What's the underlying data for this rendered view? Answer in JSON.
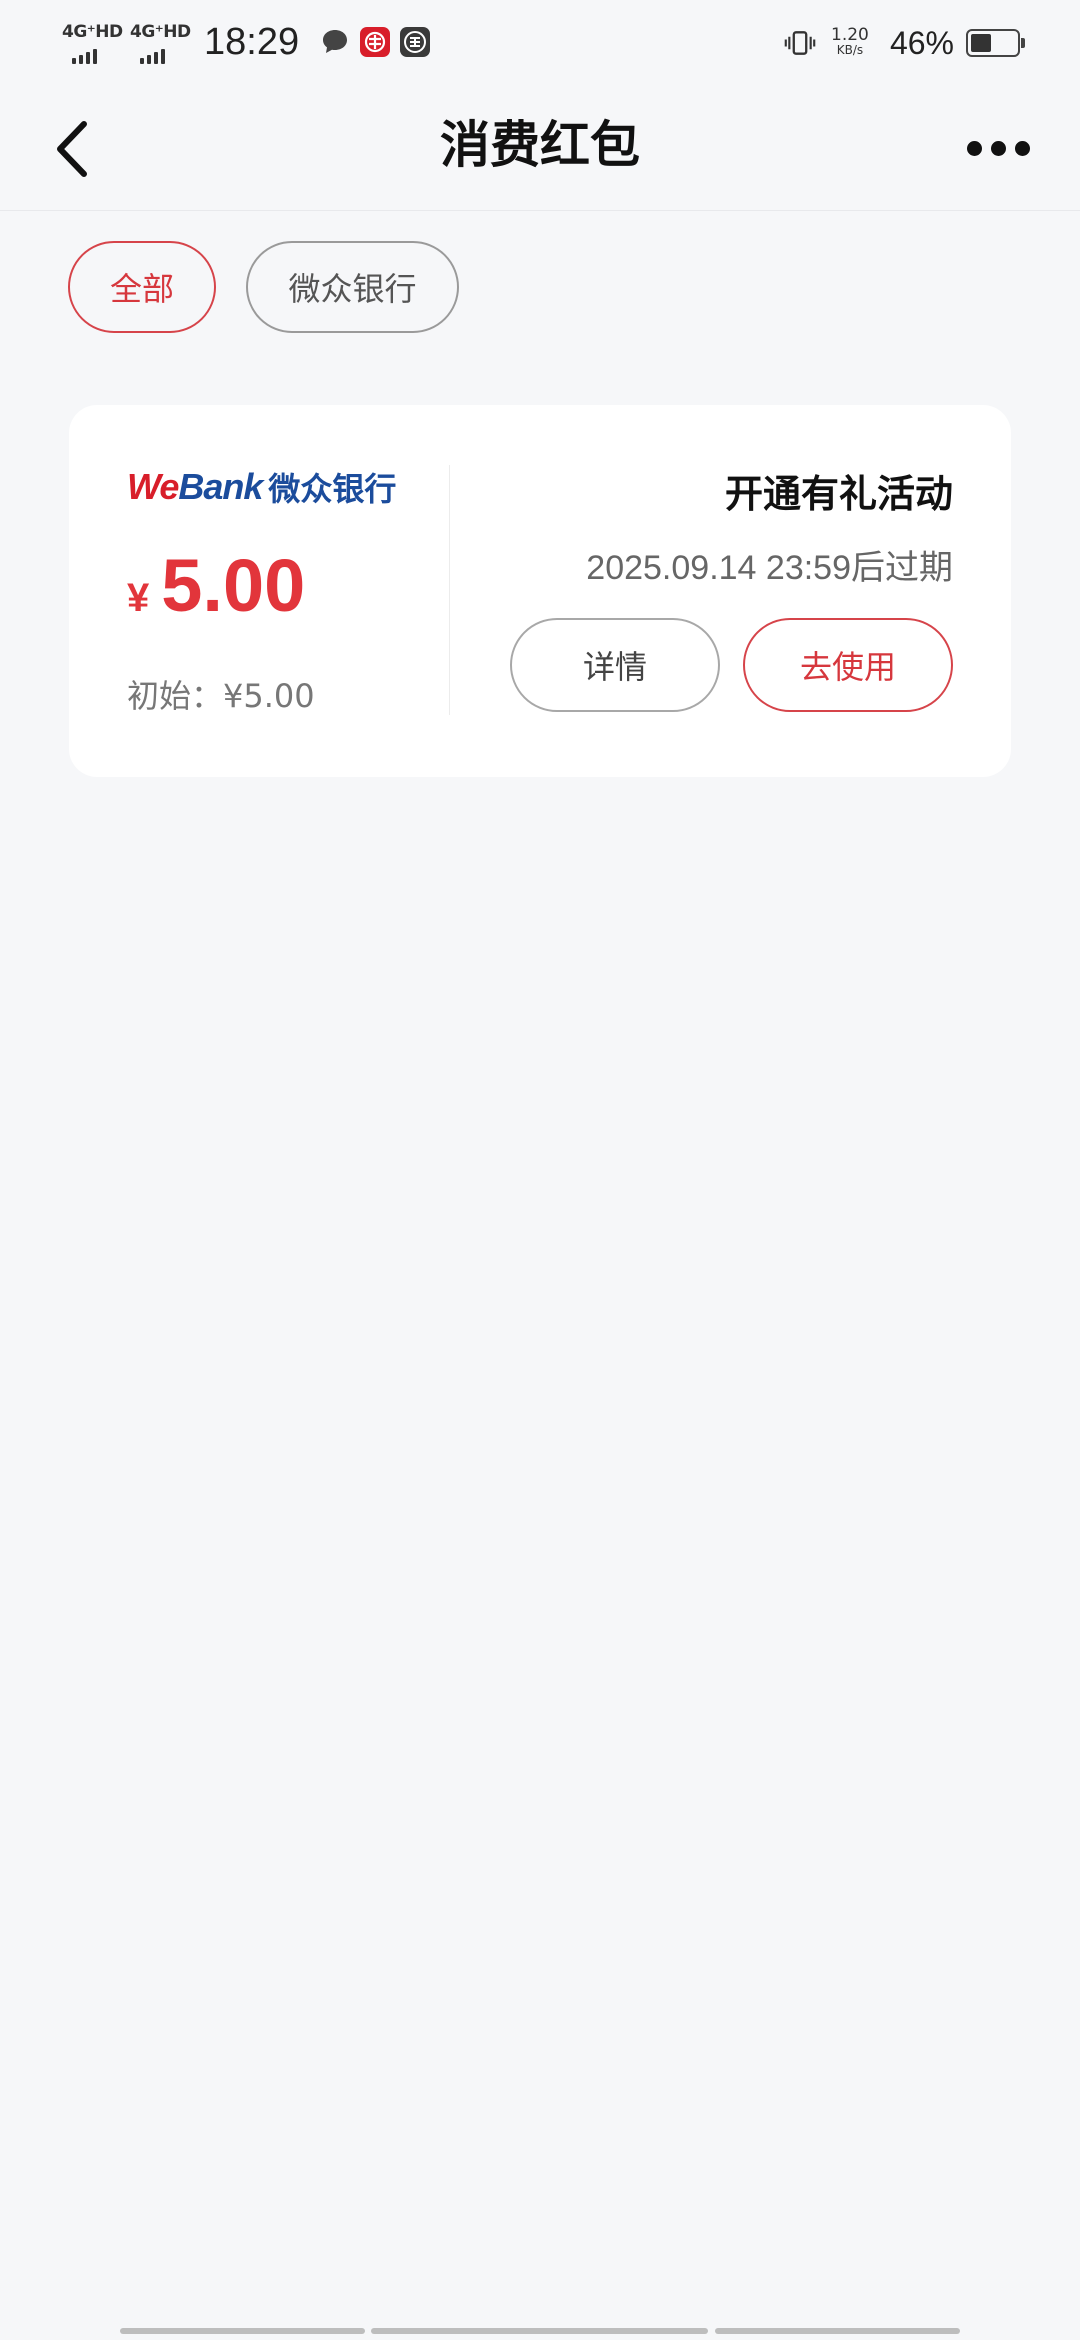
{
  "status_bar": {
    "network1": "4G⁺HD",
    "network2": "4G⁺HD",
    "time": "18:29",
    "speed_value": "1.20",
    "speed_unit": "KB/s",
    "battery_percent": "46%",
    "battery_level": 0.46
  },
  "nav": {
    "title": "消费红包"
  },
  "filters": [
    {
      "label": "全部",
      "active": true
    },
    {
      "label": "微众银行",
      "active": false
    }
  ],
  "card": {
    "logo_we": "We",
    "logo_bank": "Bank",
    "logo_cn": "微众银行",
    "currency": "¥",
    "amount": "5.00",
    "initial": "初始：¥5.00",
    "activity_title": "开通有礼活动",
    "expiry": "2025.09.14 23:59后过期",
    "detail_label": "详情",
    "use_label": "去使用"
  },
  "colors": {
    "accent_red": "#e2353b",
    "logo_blue": "#1b4c9c",
    "background": "#f6f7f9"
  }
}
